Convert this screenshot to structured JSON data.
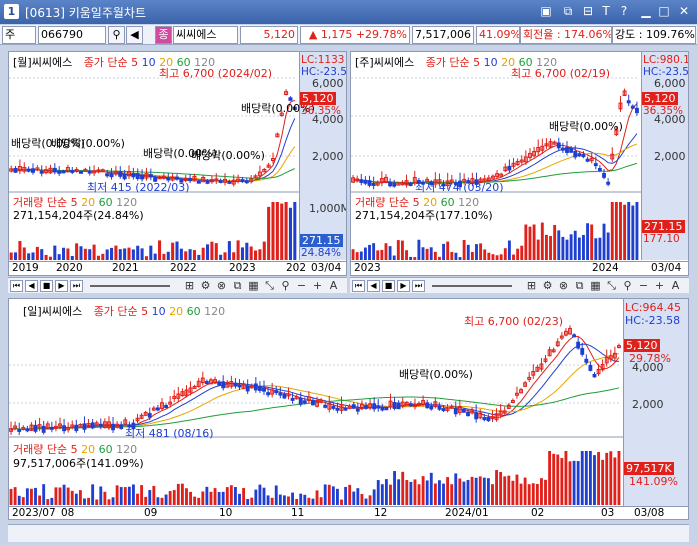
{
  "window": {
    "number": "1",
    "title": "[0613] 키움일주월차트"
  },
  "toolbar": {
    "market": "주",
    "code": "066790",
    "name": "씨씨에스",
    "price": "5,120",
    "change": "1,175",
    "change_pct": "+29.78%",
    "volume": "7,517,006",
    "vol_pct": "41.09%",
    "turnover": "회전율 : 174.06%",
    "strength": "강도 : 109.76%"
  },
  "panes": {
    "monthly": {
      "header": "[월]씨씨에스",
      "ma_label": "종가 단순",
      "ma_periods": [
        "5",
        "10",
        "20",
        "60",
        "120"
      ],
      "lc": "LC:1133",
      "hc": "HC:-23.5",
      "high_note": "최고 6,700 (2024/02)",
      "low_note": "최저 415 (2022/03)",
      "div_notes": [
        "배당락(0.00%)",
        "배당락(0.00%)",
        "배당락(0.00%)",
        "배당락(0.00%)",
        "배당락(0.00%)"
      ],
      "price_box": "5,120",
      "price_pct": "36.35%",
      "ticks": [
        "6,000",
        "4,000",
        "2,000"
      ],
      "vol_label": "거래량 단순",
      "vol_periods": [
        "5",
        "20",
        "60",
        "120"
      ],
      "vol_value": "271,154,204주(24.84%)",
      "vol_ticks": [
        "1,000M"
      ],
      "vol_box": "271.15",
      "vol_box_pct": "24.84%",
      "xlabels": [
        "2019",
        "2020",
        "2021",
        "2022",
        "2023",
        "202",
        "03/04"
      ]
    },
    "weekly": {
      "header": "[주]씨씨에스",
      "ma_label": "종가 단순",
      "ma_periods": [
        "5",
        "10",
        "20",
        "60",
        "120"
      ],
      "lc": "LC:980.1",
      "hc": "HC:-23.5",
      "high_note": "최고 6,700 (02/19)",
      "low_note": "최저 474 (03/20)",
      "div_note": "배당락(0.00%)",
      "price_box": "5,120",
      "price_pct": "36.35%",
      "ticks": [
        "6,000",
        "4,000",
        "2,000"
      ],
      "vol_label": "거래량 단순",
      "vol_periods": [
        "5",
        "20",
        "60",
        "120"
      ],
      "vol_value": "271,154,204주(177.10%)",
      "vol_box": "271.15",
      "vol_box_pct": "177.10",
      "xlabels": [
        "2023",
        "2024",
        "03/04"
      ]
    },
    "daily": {
      "header": "[일]씨씨에스",
      "ma_label": "종가 단순",
      "ma_periods": [
        "5",
        "10",
        "20",
        "60",
        "120"
      ],
      "lc": "LC:964.45",
      "hc": "HC:-23.58",
      "high_note": "최고 6,700 (02/23)",
      "low_note": "최저 481 (08/16)",
      "div_note": "배당락(0.00%)",
      "price_box": "5,120",
      "price_pct": "29.78%",
      "ticks": [
        "4,000",
        "2,000"
      ],
      "vol_label": "거래량 단순",
      "vol_periods": [
        "5",
        "20",
        "60",
        "120"
      ],
      "vol_value": "97,517,006주(141.09%)",
      "vol_box": "97,517K",
      "vol_box_pct": "141.09%",
      "xlabels": [
        "2023/07",
        "08",
        "09",
        "10",
        "11",
        "12",
        "2024/01",
        "02",
        "03",
        "03/08"
      ]
    }
  },
  "colors": {
    "up": "#e0201a",
    "down": "#1f3fd0",
    "ma5": "#e0201a",
    "ma10": "#1f3fd0",
    "ma20": "#e8a400",
    "ma60": "#1f9e3a",
    "ma120": "#888888"
  }
}
